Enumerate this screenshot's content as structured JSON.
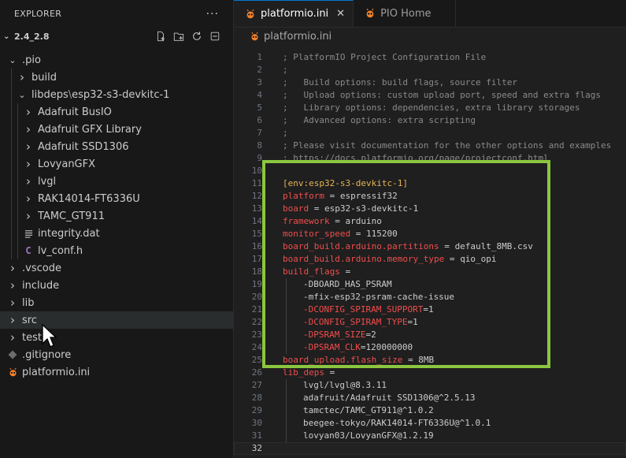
{
  "explorer": {
    "title": "EXPLORER",
    "more": "···",
    "root": "2.4_2.8",
    "items": [
      {
        "label": ".pio",
        "type": "folder-open",
        "depth": 1
      },
      {
        "label": "build",
        "type": "folder",
        "depth": 2
      },
      {
        "label": "libdeps",
        "suffix": "esp32-s3-devkitc-1",
        "sep": "\\",
        "type": "folder-open",
        "depth": 2
      },
      {
        "label": "Adafruit BusIO",
        "type": "folder",
        "depth": 3
      },
      {
        "label": "Adafruit GFX Library",
        "type": "folder",
        "depth": 3
      },
      {
        "label": "Adafruit SSD1306",
        "type": "folder",
        "depth": 3
      },
      {
        "label": "LovyanGFX",
        "type": "folder",
        "depth": 3
      },
      {
        "label": "lvgl",
        "type": "folder",
        "depth": 3
      },
      {
        "label": "RAK14014-FT6336U",
        "type": "folder",
        "depth": 3
      },
      {
        "label": "TAMC_GT911",
        "type": "folder",
        "depth": 3
      },
      {
        "label": "integrity.dat",
        "type": "file-lines",
        "depth": 3
      },
      {
        "label": "lv_conf.h",
        "type": "file-c",
        "icon_text": "C",
        "depth": 3
      },
      {
        "label": ".vscode",
        "type": "folder",
        "depth": 1
      },
      {
        "label": "include",
        "type": "folder",
        "depth": 1
      },
      {
        "label": "lib",
        "type": "folder",
        "depth": 1
      },
      {
        "label": "src",
        "type": "folder",
        "depth": 1
      },
      {
        "label": "test",
        "type": "folder",
        "depth": 1
      },
      {
        "label": ".gitignore",
        "type": "file-git",
        "depth": 0
      },
      {
        "label": "platformio.ini",
        "type": "file-pio",
        "depth": 0
      }
    ]
  },
  "tabs": [
    {
      "label": "platformio.ini",
      "active": true,
      "icon": "platformio-icon"
    },
    {
      "label": "PIO Home",
      "active": false,
      "icon": "platformio-icon"
    }
  ],
  "breadcrumb": {
    "file": "platformio.ini"
  },
  "code_lines": [
    {
      "n": "1",
      "parts": [
        [
          "comment",
          "; PlatformIO Project Configuration File"
        ]
      ]
    },
    {
      "n": "2",
      "parts": [
        [
          "comment",
          ";"
        ]
      ]
    },
    {
      "n": "3",
      "parts": [
        [
          "comment",
          ";   Build options: build flags, source filter"
        ]
      ]
    },
    {
      "n": "4",
      "parts": [
        [
          "comment",
          ";   Upload options: custom upload port, speed and extra flags"
        ]
      ]
    },
    {
      "n": "5",
      "parts": [
        [
          "comment",
          ";   Library options: dependencies, extra library storages"
        ]
      ]
    },
    {
      "n": "6",
      "parts": [
        [
          "comment",
          ";   Advanced options: extra scripting"
        ]
      ]
    },
    {
      "n": "7",
      "parts": [
        [
          "comment",
          ";"
        ]
      ]
    },
    {
      "n": "8",
      "parts": [
        [
          "comment",
          "; Please visit documentation for the other options and examples"
        ]
      ]
    },
    {
      "n": "9",
      "parts": [
        [
          "comment",
          "; https://docs.platformio.org/page/projectconf.html"
        ]
      ]
    },
    {
      "n": "10",
      "parts": []
    },
    {
      "n": "11",
      "parts": [
        [
          "sect",
          "[env:esp32-s3-devkitc-1]"
        ]
      ]
    },
    {
      "n": "12",
      "parts": [
        [
          "key",
          "platform"
        ],
        [
          "eq",
          " = "
        ],
        [
          "val",
          "espressif32"
        ]
      ]
    },
    {
      "n": "13",
      "parts": [
        [
          "key",
          "board"
        ],
        [
          "eq",
          " = "
        ],
        [
          "val",
          "esp32-s3-devkitc-1"
        ]
      ]
    },
    {
      "n": "14",
      "parts": [
        [
          "key",
          "framework"
        ],
        [
          "eq",
          " = "
        ],
        [
          "val",
          "arduino"
        ]
      ]
    },
    {
      "n": "15",
      "parts": [
        [
          "key",
          "monitor_speed"
        ],
        [
          "eq",
          " = "
        ],
        [
          "val",
          "115200"
        ]
      ]
    },
    {
      "n": "16",
      "parts": [
        [
          "key",
          "board_build.arduino.partitions"
        ],
        [
          "eq",
          " = "
        ],
        [
          "val",
          "default_8MB.csv"
        ]
      ]
    },
    {
      "n": "17",
      "parts": [
        [
          "key",
          "board_build.arduino.memory_type"
        ],
        [
          "eq",
          " = "
        ],
        [
          "val",
          "qio_opi"
        ]
      ]
    },
    {
      "n": "18",
      "parts": [
        [
          "key",
          "build_flags"
        ],
        [
          "eq",
          " ="
        ]
      ]
    },
    {
      "n": "19",
      "indent": true,
      "parts": [
        [
          "flag",
          "-DBOARD_HAS_PSRAM"
        ]
      ]
    },
    {
      "n": "20",
      "indent": true,
      "parts": [
        [
          "flag",
          "-mfix-esp32-psram-cache-issue"
        ]
      ]
    },
    {
      "n": "21",
      "indent": true,
      "parts": [
        [
          "flagkey",
          "-DCONFIG_SPIRAM_SUPPORT"
        ],
        [
          "eq",
          "=1"
        ]
      ]
    },
    {
      "n": "22",
      "indent": true,
      "parts": [
        [
          "flagkey",
          "-DCONFIG_SPIRAM_TYPE"
        ],
        [
          "eq",
          "=1"
        ]
      ]
    },
    {
      "n": "23",
      "indent": true,
      "parts": [
        [
          "flagkey",
          "-DPSRAM_SIZE"
        ],
        [
          "eq",
          "=2"
        ]
      ]
    },
    {
      "n": "24",
      "indent": true,
      "parts": [
        [
          "flagkey",
          "-DPSRAM_CLK"
        ],
        [
          "eq",
          "=120000000"
        ]
      ]
    },
    {
      "n": "25",
      "parts": [
        [
          "key",
          "board_upload.flash_size"
        ],
        [
          "eq",
          " = "
        ],
        [
          "val",
          "8MB"
        ]
      ]
    },
    {
      "n": "26",
      "parts": [
        [
          "key",
          "lib_deps"
        ],
        [
          "eq",
          " ="
        ]
      ]
    },
    {
      "n": "27",
      "indent": true,
      "parts": [
        [
          "val",
          "lvgl/lvgl@8.3.11"
        ]
      ]
    },
    {
      "n": "28",
      "indent": true,
      "parts": [
        [
          "val",
          "adafruit/Adafruit SSD1306@^2.5.13"
        ]
      ]
    },
    {
      "n": "29",
      "indent": true,
      "parts": [
        [
          "val",
          "tamctec/TAMC_GT911@^1.0.2"
        ]
      ]
    },
    {
      "n": "30",
      "indent": true,
      "parts": [
        [
          "val",
          "beegee-tokyo/RAK14014-FT6336U@^1.0.1"
        ]
      ]
    },
    {
      "n": "31",
      "indent": true,
      "parts": [
        [
          "val",
          "lovyan03/LovyanGFX@1.2.19"
        ]
      ]
    },
    {
      "n": "32",
      "current": true,
      "parts": []
    }
  ],
  "colors": {
    "highlight_border": "#8cc63f",
    "pio_orange": "#f5822a"
  }
}
